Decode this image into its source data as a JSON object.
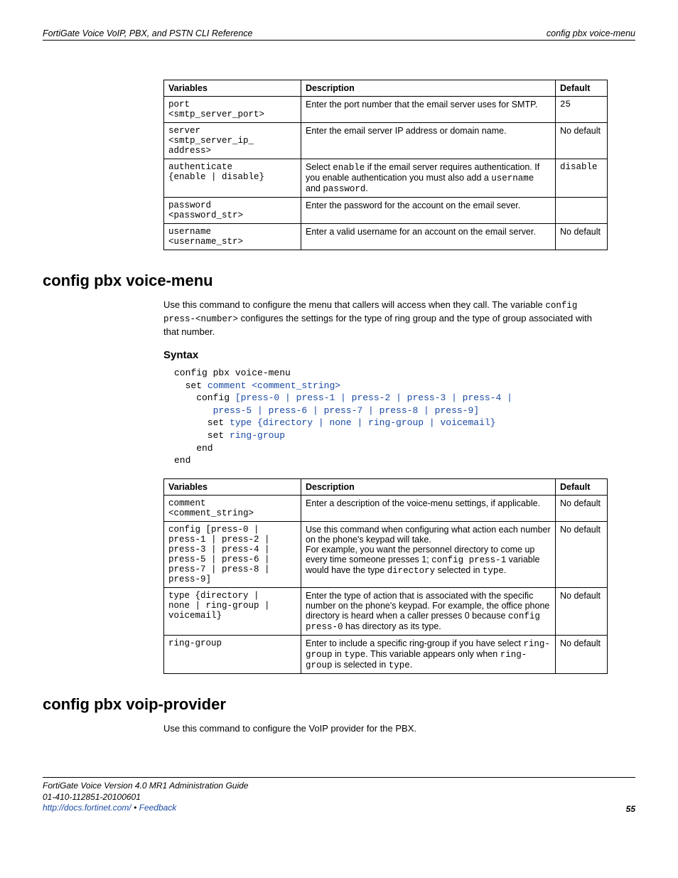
{
  "header": {
    "left": "FortiGate Voice VoIP, PBX, and PSTN CLI Reference",
    "right": "config pbx voice-menu"
  },
  "table1": {
    "headers": [
      "Variables",
      "Description",
      "Default"
    ],
    "rows": [
      {
        "var": "port\n<smtp_server_port>",
        "desc_html": "Enter the port number that the email server uses for SMTP.",
        "def": "25"
      },
      {
        "var": "server\n<smtp_server_ip_\naddress>",
        "desc_html": "Enter the email server IP address or domain name.",
        "def": "No default"
      },
      {
        "var": "authenticate\n{enable | disable}",
        "desc_html": "Select <span class=\"mono\">enable</span> if the email server requires authentication. If you enable authentication you must also add a <span class=\"mono\">username</span> and <span class=\"mono\">password</span>.",
        "def": "disable"
      },
      {
        "var": "password\n<password_str>",
        "desc_html": "Enter the password for the account on the email sever.",
        "def": ""
      },
      {
        "var": "username\n<username_str>",
        "desc_html": "Enter a valid username for an account on the email server.",
        "def": "No default"
      }
    ]
  },
  "section1": {
    "title": "config pbx voice-menu",
    "intro_html": "Use this command to configure the menu that callers will access when they call. The variable <span class=\"mono\">config press-&lt;number&gt;</span> configures the settings for the type of ring group and the type of group associated with that number.",
    "syntax_label": "Syntax",
    "syntax_html": "config pbx voice-menu\n  set <span class=\"blue\">comment &lt;comment_string&gt;</span>\n    config <span class=\"blue\">[press-0 | press-1 | press-2 | press-3 | press-4 |\n       press-5 | press-6 | press-7 | press-8 | press-9]</span>\n      set <span class=\"blue\">type {directory | none | ring-group | voicemail}</span>\n      set <span class=\"blue\">ring-group</span>\n    end\nend"
  },
  "table2": {
    "headers": [
      "Variables",
      "Description",
      "Default"
    ],
    "rows": [
      {
        "var": "comment\n<comment_string>",
        "desc_html": "Enter a description of the voice-menu settings, if applicable.",
        "def": "No default"
      },
      {
        "var": "config [press-0 |\npress-1 | press-2 |\npress-3 | press-4 |\npress-5 | press-6 |\npress-7 | press-8 |\npress-9]",
        "desc_html": "Use this command when configuring what action each number on the phone's keypad will take.<br>For example, you want the personnel directory to come up every time someone presses 1; <span class=\"mono\">config press-1</span> variable would have the type <span class=\"mono\">directory</span> selected in <span class=\"mono\">type</span>.",
        "def": "No default"
      },
      {
        "var": "type {directory |\nnone | ring-group |\nvoicemail}",
        "desc_html": "Enter the type of action that is associated with the specific number on the phone's keypad. For example, the office phone directory is heard when a caller presses 0 because <span class=\"mono\">config press-0</span> has directory as its type.",
        "def": "No default"
      },
      {
        "var": "ring-group",
        "desc_html": "Enter to include a specific ring-group if you have select <span class=\"mono\">ring-group</span> in <span class=\"mono\">type</span>. This variable appears only when <span class=\"mono\">ring-group</span> is selected in <span class=\"mono\">type</span>.",
        "def": "No default"
      }
    ]
  },
  "section2": {
    "title": "config pbx voip-provider",
    "intro": "Use this command to configure the VoIP provider for the PBX."
  },
  "footer": {
    "line1": "FortiGate Voice Version 4.0 MR1 Administration Guide",
    "line2": "01-410-112851-20100601",
    "link1": "http://docs.fortinet.com/",
    "sep": " • ",
    "link2": "Feedback",
    "page": "55"
  }
}
